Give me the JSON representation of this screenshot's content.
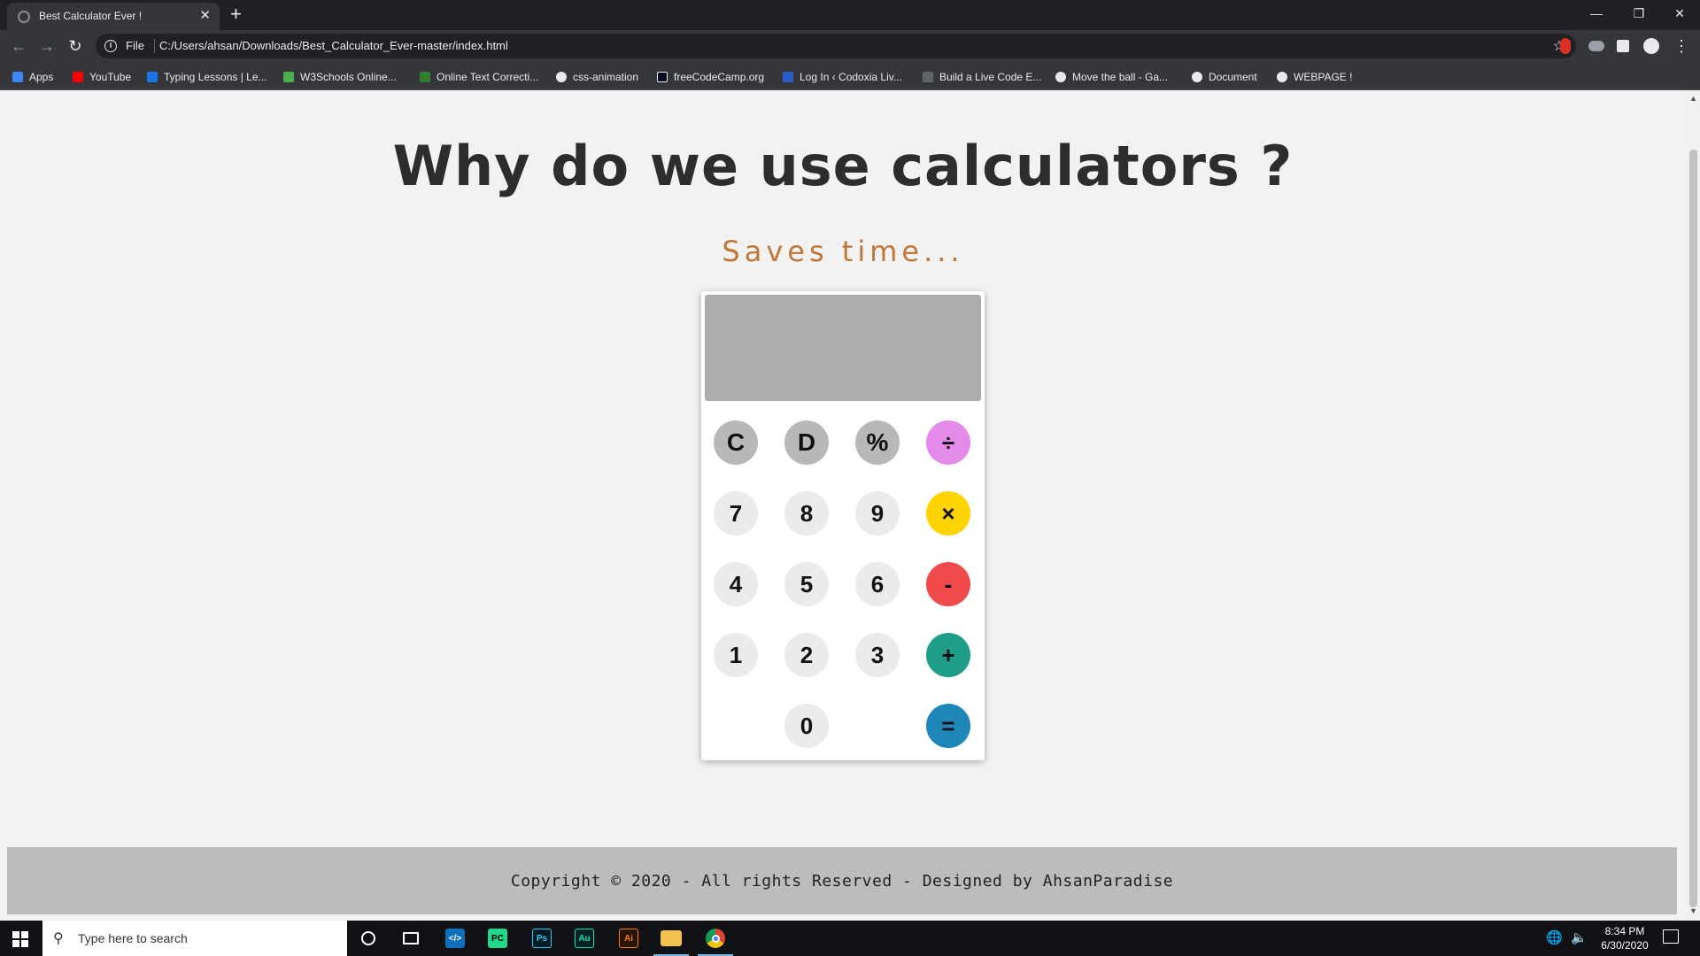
{
  "browser": {
    "tab_title": "Best Calculator Ever !",
    "tab_close": "✕",
    "new_tab": "+",
    "scheme_label": "File",
    "url": "C:/Users/ahsan/Downloads/Best_Calculator_Ever-master/index.html",
    "window_controls": {
      "minimize": "—",
      "restore": "❐",
      "close": "✕"
    }
  },
  "bookmarks": [
    {
      "label": "Apps",
      "color": "#4285f4"
    },
    {
      "label": "YouTube",
      "color": "#ff0000"
    },
    {
      "label": "Typing Lessons | Le...",
      "color": "#1a73e8"
    },
    {
      "label": "W3Schools Online...",
      "color": "#4caf50"
    },
    {
      "label": "Online Text Correcti...",
      "color": "#2e7d32"
    },
    {
      "label": "css-animation",
      "color": "#e8eaed"
    },
    {
      "label": "freeCodeCamp.org",
      "color": "#0a0a23"
    },
    {
      "label": "Log In ‹ Codoxia Liv...",
      "color": "#2c5cc5"
    },
    {
      "label": "Build a Live Code E...",
      "color": "#5f6368"
    },
    {
      "label": "Move the ball - Ga...",
      "color": "#e8eaed"
    },
    {
      "label": "Document",
      "color": "#e8eaed"
    },
    {
      "label": "WEBPAGE !",
      "color": "#e8eaed"
    }
  ],
  "page": {
    "heading": "Why do we use calculators ?",
    "subheading": "Saves time...",
    "display_value": "",
    "keys": {
      "clear": "C",
      "delete": "D",
      "percent": "%",
      "divide": "÷",
      "seven": "7",
      "eight": "8",
      "nine": "9",
      "multiply": "×",
      "four": "4",
      "five": "5",
      "six": "6",
      "subtract": "-",
      "one": "1",
      "two": "2",
      "three": "3",
      "add": "+",
      "zero": "0",
      "equals": "="
    },
    "footer": "Copyright © 2020 - All rights Reserved - Designed by AhsanParadise"
  },
  "colors": {
    "heading": "#2d2d2d",
    "subheading": "#c0773a",
    "divide_key": "#e48ae8",
    "multiply_key": "#ffd400",
    "subtract_key": "#ef4b4b",
    "add_key": "#1f9e8a",
    "equals_key": "#1f86b8"
  },
  "taskbar": {
    "search_placeholder": "Type here to search",
    "time": "8:34 PM",
    "date": "6/30/2020"
  }
}
